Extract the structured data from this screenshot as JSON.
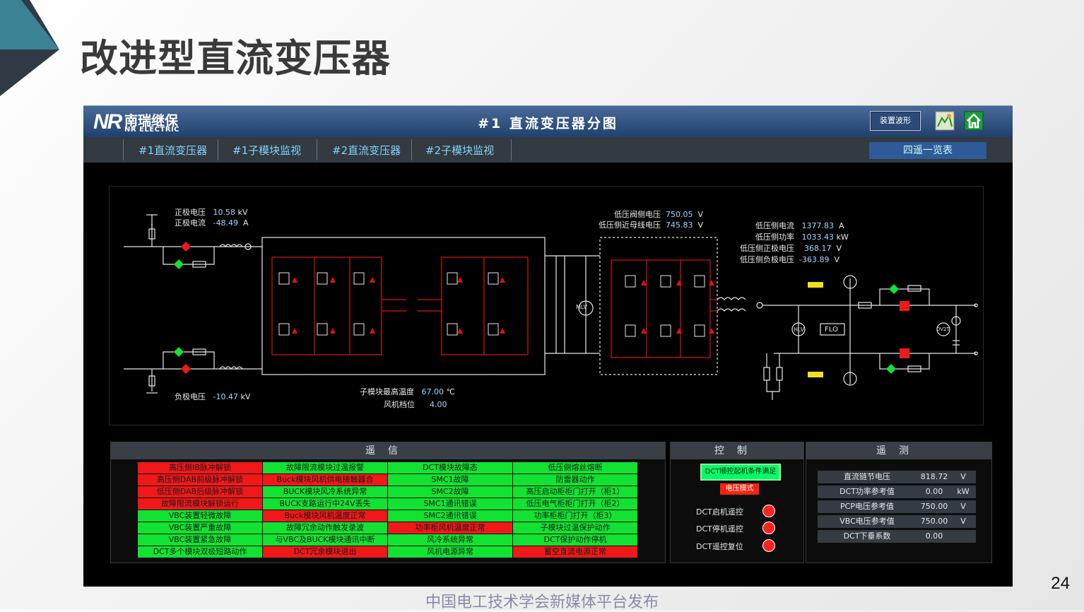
{
  "slide": {
    "title": "改进型直流变压器",
    "page_number": "24",
    "footer": "中国电工技术学会新媒体平台发布"
  },
  "header": {
    "logo_mark": "NR",
    "logo_cn": "南瑞继保",
    "logo_en": "NR ELECTRIC",
    "title": "#1 直流变压器分图",
    "waveform_button": "装置波形",
    "icons": [
      "network-icon",
      "home-icon"
    ]
  },
  "nav": {
    "tabs": [
      "#1直流变压器",
      "#1子模块监视",
      "#2直流变压器",
      "#2子模块监视"
    ],
    "overview_button": "四遥一览表"
  },
  "diagram": {
    "readings": {
      "pos_voltage": {
        "label": "正极电压",
        "value": "10.58",
        "unit": "kV"
      },
      "pos_current": {
        "label": "正极电流",
        "value": "-48.49",
        "unit": "A"
      },
      "neg_voltage": {
        "label": "负极电压",
        "value": "-10.47",
        "unit": "kV"
      },
      "submodule_max_temp": {
        "label": "子模块最高温度",
        "value": "67.00",
        "unit": "℃"
      },
      "fan_level": {
        "label": "风机档位",
        "value": "4.00",
        "unit": ""
      },
      "lv_valve_voltage": {
        "label": "低压阀侧电压",
        "value": "750.05",
        "unit": "V"
      },
      "lv_bus_voltage": {
        "label": "低压侧近母线电压",
        "value": "745.83",
        "unit": "V"
      },
      "lv_current": {
        "label": "低压侧电流",
        "value": "1377.83",
        "unit": "A"
      },
      "lv_power": {
        "label": "低压侧功率",
        "value": "1033.43",
        "unit": "kW"
      },
      "lv_pos_voltage": {
        "label": "低压侧正极电压",
        "value": "368.17",
        "unit": "V"
      },
      "lv_neg_voltage": {
        "label": "低压侧负极电压",
        "value": "-363.89",
        "unit": "V"
      }
    },
    "symbols": {
      "mlv": "MLV",
      "hlv": "HLV",
      "flo": "FLO",
      "dv2t": "DV2T"
    }
  },
  "telesignal": {
    "title": "遥信",
    "items": [
      {
        "label": "高压侧IB脉冲解锁",
        "state": "alarm"
      },
      {
        "label": "故障限流模块过温报警",
        "state": "normal"
      },
      {
        "label": "DCT模块故障态",
        "state": "normal"
      },
      {
        "label": "低压侧熔丝熔断",
        "state": "normal"
      },
      {
        "label": "高压侧DAB前级脉冲解锁",
        "state": "alarm"
      },
      {
        "label": "Buck模块风机供电接触器合",
        "state": "alarm"
      },
      {
        "label": "SMC1故障",
        "state": "normal"
      },
      {
        "label": "防雷器动作",
        "state": "normal"
      },
      {
        "label": "低压侧DAB后级脉冲解锁",
        "state": "alarm"
      },
      {
        "label": "BUCK模块风冷系统异常",
        "state": "normal"
      },
      {
        "label": "SMC2故障",
        "state": "normal"
      },
      {
        "label": "高压启动柜柜门打开（柜1）",
        "state": "normal"
      },
      {
        "label": "故障限流模块解锁运行",
        "state": "alarm"
      },
      {
        "label": "BUCK支路运行中24V丢失",
        "state": "normal"
      },
      {
        "label": "SMC1通讯错误",
        "state": "normal"
      },
      {
        "label": "低压电气柜柜门打开（柜2）",
        "state": "normal"
      },
      {
        "label": "VBC装置轻微故障",
        "state": "normal"
      },
      {
        "label": "Buck模块风机温度正常",
        "state": "alarm"
      },
      {
        "label": "SMC2通讯错误",
        "state": "normal"
      },
      {
        "label": "功率柜柜门打开（柜3）",
        "state": "normal"
      },
      {
        "label": "VBC装置严重故障",
        "state": "normal"
      },
      {
        "label": "故障冗余动作触发录波",
        "state": "normal"
      },
      {
        "label": "功率柜风机温度正常",
        "state": "alarm"
      },
      {
        "label": "子模块过温保护动作",
        "state": "normal"
      },
      {
        "label": "VBC装置紧急故障",
        "state": "normal"
      },
      {
        "label": "与VBC及BUCK模块通讯中断",
        "state": "normal"
      },
      {
        "label": "风冷系统异常",
        "state": "normal"
      },
      {
        "label": "DCT保护动作停机",
        "state": "normal"
      },
      {
        "label": "DCT多个模块双极短路动作",
        "state": "normal"
      },
      {
        "label": "DCT冗余模块退出",
        "state": "alarm"
      },
      {
        "label": "风机电源异常",
        "state": "normal"
      },
      {
        "label": "蓄空直流电源正常",
        "state": "alarm"
      }
    ],
    "colors": {
      "alarm": "#f01818",
      "normal": "#12e232"
    }
  },
  "control": {
    "title": "控制",
    "condition_button": "DCT顺控起机条件满足",
    "mode_button": "电压模式",
    "commands": [
      "DCT启机遥控",
      "DCT停机遥控",
      "DCT遥控复位"
    ]
  },
  "measure": {
    "title": "遥测",
    "rows": [
      {
        "label": "直流链节电压",
        "value": "818.72",
        "unit": "V"
      },
      {
        "label": "DCT功率参考值",
        "value": "0.00",
        "unit": "kW"
      },
      {
        "label": "PCP电压参考值",
        "value": "750.00",
        "unit": "V"
      },
      {
        "label": "VBC电压参考值",
        "value": "750.00",
        "unit": "V"
      },
      {
        "label": "DCT下垂系数",
        "value": "0.00",
        "unit": ""
      }
    ]
  }
}
